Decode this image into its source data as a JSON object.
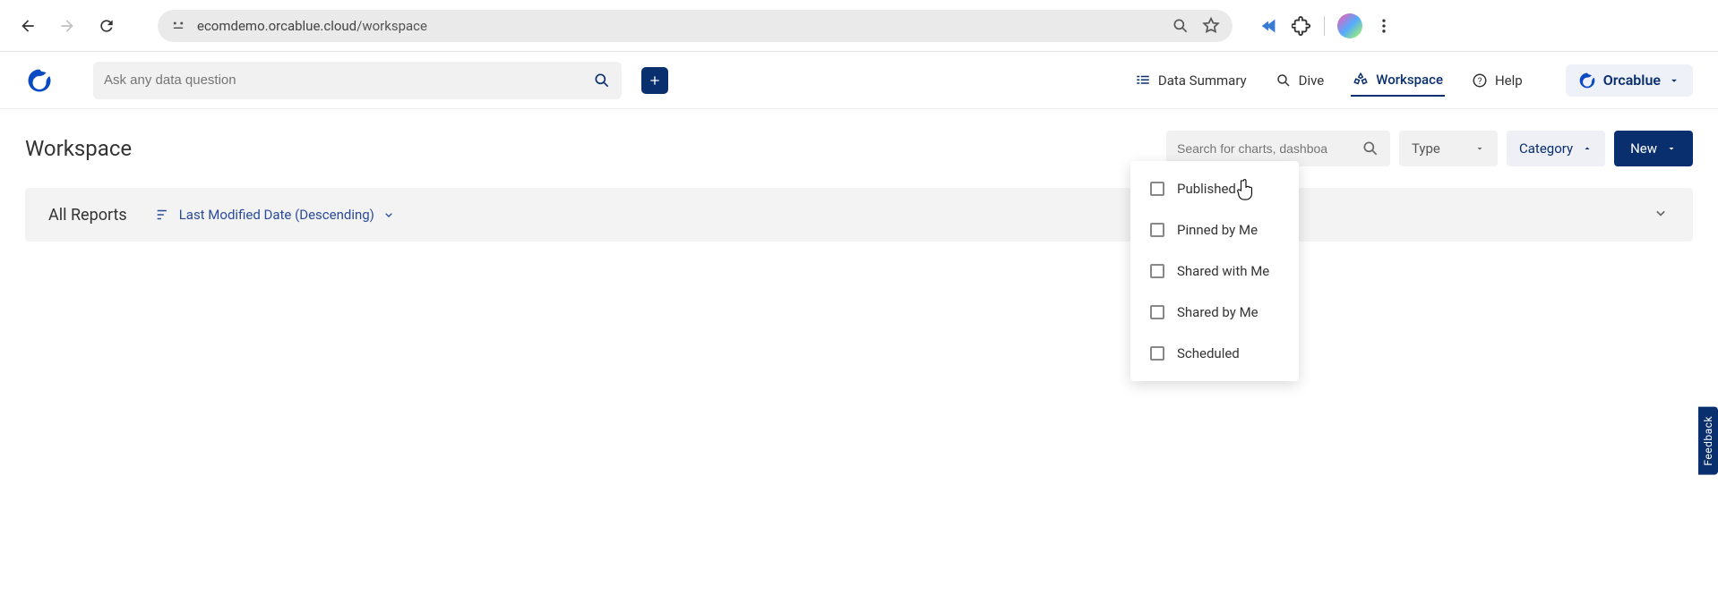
{
  "browser": {
    "url_host": "ecomdemo.orcablue.cloud",
    "url_path": "/workspace"
  },
  "header": {
    "ask_placeholder": "Ask any data question",
    "nav": {
      "summary": "Data Summary",
      "dive": "Dive",
      "workspace": "Workspace",
      "help": "Help"
    },
    "brand": "Orcablue"
  },
  "page": {
    "title": "Workspace"
  },
  "toolbar": {
    "search_placeholder": "Search for charts, dashboa",
    "type": "Type",
    "category": "Category",
    "new": "New"
  },
  "dropdown": {
    "items": [
      {
        "label": "Published"
      },
      {
        "label": "Pinned by Me"
      },
      {
        "label": "Shared with Me"
      },
      {
        "label": "Shared by Me"
      },
      {
        "label": "Scheduled"
      }
    ]
  },
  "reports": {
    "all": "All Reports",
    "sort": "Last Modified Date (Descending)"
  },
  "feedback": "Feedback"
}
